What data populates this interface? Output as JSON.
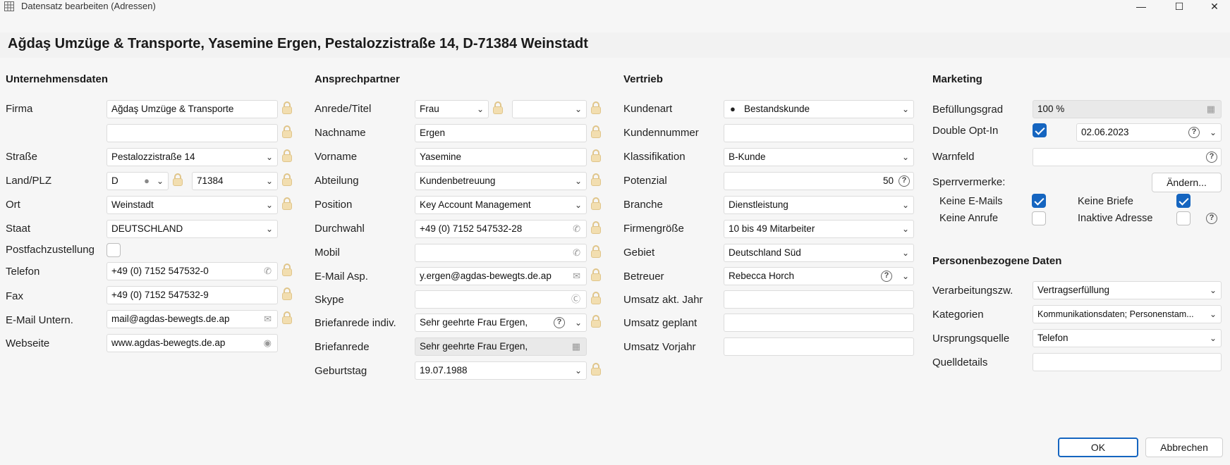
{
  "window": {
    "title": "Datensatz bearbeiten (Adressen)"
  },
  "headline": "Ağdaş Umzüge & Transporte, Yasemine Ergen, Pestalozzistraße 14, D-71384 Weinstadt",
  "unternehmen": {
    "title": "Unternehmensdaten",
    "firma_label": "Firma",
    "firma": "Ağdaş Umzüge & Transporte",
    "firma2": "",
    "strasse_label": "Straße",
    "strasse": "Pestalozzistraße 14",
    "landplz_label": "Land/PLZ",
    "land": "D",
    "plz": "71384",
    "ort_label": "Ort",
    "ort": "Weinstadt",
    "staat_label": "Staat",
    "staat": "DEUTSCHLAND",
    "postfach_label": "Postfachzustellung",
    "telefon_label": "Telefon",
    "telefon": "+49 (0) 7152 547532-0",
    "fax_label": "Fax",
    "fax": "+49 (0) 7152 547532-9",
    "email_label": "E-Mail Untern.",
    "email": "mail@agdas-bewegts.de.ap",
    "web_label": "Webseite",
    "web": "www.agdas-bewegts.de.ap"
  },
  "ansprech": {
    "title": "Ansprechpartner",
    "anrede_label": "Anrede/Titel",
    "anrede": "Frau",
    "titel": "",
    "nachname_label": "Nachname",
    "nachname": "Ergen",
    "vorname_label": "Vorname",
    "vorname": "Yasemine",
    "abteilung_label": "Abteilung",
    "abteilung": "Kundenbetreuung",
    "position_label": "Position",
    "position": "Key Account Management",
    "durchwahl_label": "Durchwahl",
    "durchwahl": "+49 (0) 7152 547532-28",
    "mobil_label": "Mobil",
    "mobil": "",
    "email_label": "E-Mail Asp.",
    "email": "y.ergen@agdas-bewegts.de.ap",
    "skype_label": "Skype",
    "skype": "",
    "briefindiv_label": "Briefanrede indiv.",
    "briefindiv": "Sehr geehrte Frau Ergen,",
    "brief_label": "Briefanrede",
    "brief": "Sehr geehrte Frau Ergen,",
    "geburtstag_label": "Geburtstag",
    "geburtstag": "19.07.1988"
  },
  "vertrieb": {
    "title": "Vertrieb",
    "kundenart_label": "Kundenart",
    "kundenart": "Bestandskunde",
    "kundennr_label": "Kundennummer",
    "kundennr": "",
    "klass_label": "Klassifikation",
    "klass": "B-Kunde",
    "potenzial_label": "Potenzial",
    "potenzial": "50",
    "branche_label": "Branche",
    "branche": "Dienstleistung",
    "groesse_label": "Firmengröße",
    "groesse": "10 bis 49 Mitarbeiter",
    "gebiet_label": "Gebiet",
    "gebiet": "Deutschland Süd",
    "betreuer_label": "Betreuer",
    "betreuer": "Rebecca Horch",
    "umsatz_akt_label": "Umsatz akt. Jahr",
    "umsatz_akt": "",
    "umsatz_geplant_label": "Umsatz geplant",
    "umsatz_geplant": "",
    "umsatz_vorjahr_label": "Umsatz Vorjahr",
    "umsatz_vorjahr": ""
  },
  "marketing": {
    "title": "Marketing",
    "befuellung_label": "Befüllungsgrad",
    "befuellung": "100 %",
    "optin_label": "Double Opt-In",
    "optin_checked": true,
    "optin_date": "02.06.2023",
    "warnfeld_label": "Warnfeld",
    "warnfeld": "",
    "sperr_label": "Sperrvermerke:",
    "aendern": "Ändern...",
    "keine_emails": "Keine E-Mails",
    "keine_briefe": "Keine Briefe",
    "keine_anrufe": "Keine Anrufe",
    "inaktiv": "Inaktive Adresse"
  },
  "personen": {
    "title": "Personenbezogene Daten",
    "verarb_label": "Verarbeitungszw.",
    "verarb": "Vertragserfüllung",
    "kategorien_label": "Kategorien",
    "kategorien": "Kommunikationsdaten; Personenstam...",
    "ursprung_label": "Ursprungsquelle",
    "ursprung": "Telefon",
    "quell_label": "Quelldetails",
    "quell": ""
  },
  "buttons": {
    "ok": "OK",
    "cancel": "Abbrechen"
  },
  "colors": {
    "accent": "#1565c0",
    "lock": "#e0c58a",
    "background": "#f6f6f6"
  }
}
